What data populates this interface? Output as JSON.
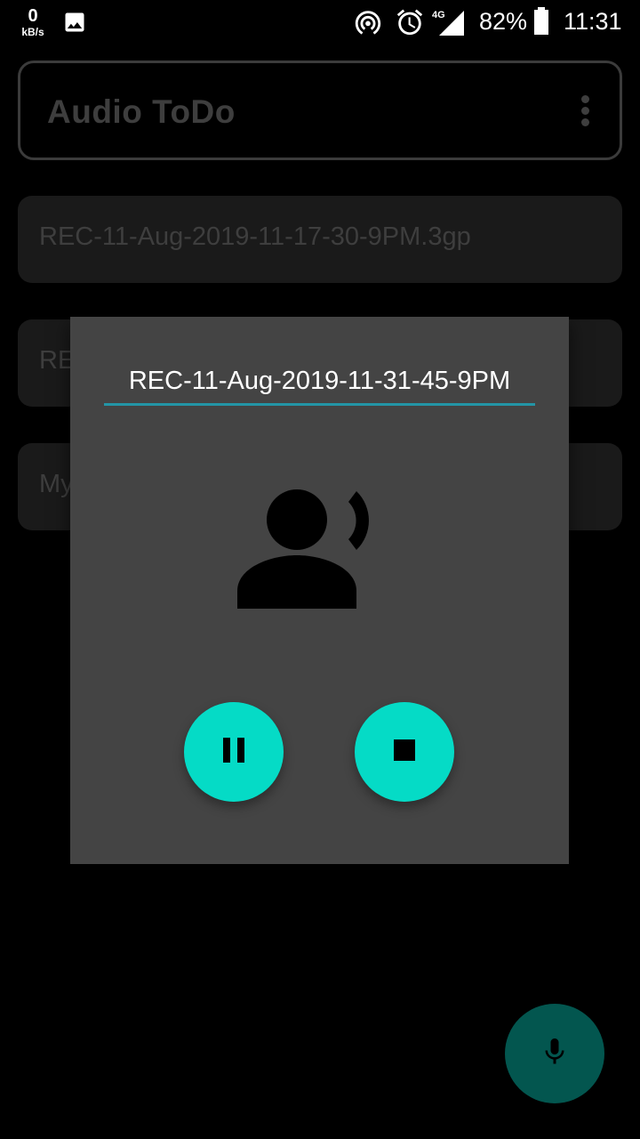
{
  "status_bar": {
    "net_speed_value": "0",
    "net_speed_unit": "kB/s",
    "network_type": "4G",
    "battery_percent": "82%",
    "time": "11:31"
  },
  "app_bar": {
    "title": "Audio ToDo",
    "menu_icon": "more-vert-icon"
  },
  "recordings": [
    {
      "label": "REC-11-Aug-2019-11-17-30-9PM.3gp"
    },
    {
      "label": "RE"
    },
    {
      "label": "My"
    }
  ],
  "record_dialog": {
    "file_name_value": "REC-11-Aug-2019-11-31-45-9PM",
    "status_icon": "voice-recording-icon",
    "pause_icon": "pause-icon",
    "stop_icon": "stop-icon"
  },
  "fab": {
    "icon": "mic-icon"
  },
  "colors": {
    "accent": "#05dbc6",
    "accent_dim": "#03564f",
    "dialog_bg": "#444444",
    "underline": "#2395a6",
    "card_bg": "#1a1a1a",
    "dim_text": "#3e3e3e"
  }
}
